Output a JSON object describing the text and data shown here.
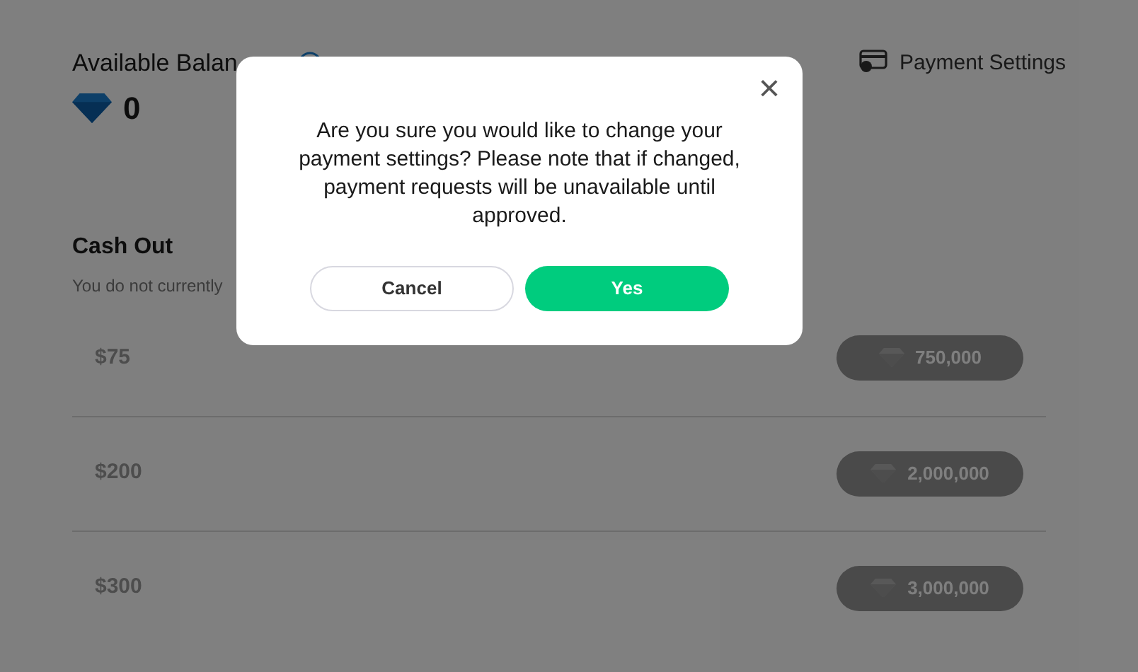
{
  "balance": {
    "label": "Available Balan",
    "amount": "0"
  },
  "payment_settings": {
    "label": "Payment Settings"
  },
  "cash_out": {
    "title": "Cash Out",
    "subtitle": "You do not currently",
    "rows": [
      {
        "price": "$75",
        "cost": "750,000",
        "disabled": true
      },
      {
        "price": "$200",
        "cost": "2,000,000",
        "disabled": true
      },
      {
        "price": "$300",
        "cost": "3,000,000",
        "disabled": true
      }
    ]
  },
  "dialog": {
    "close": "×",
    "message": "Are you sure you would like to change your payment settings? Please note that if changed, payment requests will be unavailable until approved.",
    "buttons": [
      {
        "label": "Cancel",
        "kind": "secondary"
      },
      {
        "label": "Yes",
        "kind": "primary"
      }
    ]
  }
}
